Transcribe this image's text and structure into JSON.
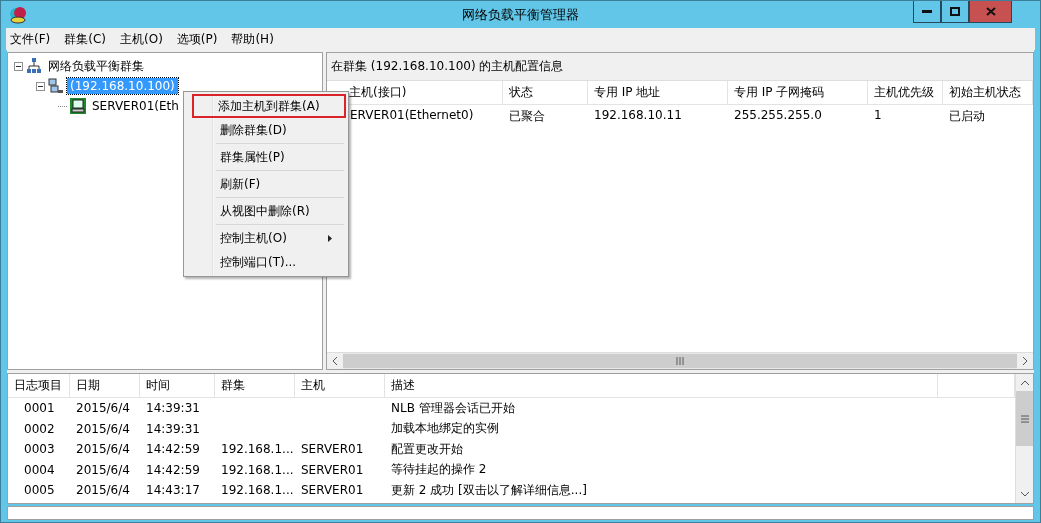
{
  "window": {
    "title": "网络负载平衡管理器"
  },
  "menu_bar": [
    "文件(F)",
    "群集(C)",
    "主机(O)",
    "选项(P)",
    "帮助(H)"
  ],
  "tree": {
    "label": "网络负载平衡群集",
    "selected": false,
    "expanded": true,
    "children": [
      {
        "label": "(192.168.10.100)",
        "selected": true,
        "expanded": true,
        "children": [
          {
            "label": "SERVER01(Eth",
            "selected": false
          }
        ]
      }
    ]
  },
  "details": {
    "caption": "在群集 (192.168.10.100) 的主机配置信息",
    "columns": [
      "主机(接口)",
      "状态",
      "专用 IP 地址",
      "专用 IP 子网掩码",
      "主机优先级",
      "初始主机状态"
    ],
    "rows": [
      [
        "ERVER01(Ethernet0)",
        "已聚合",
        "192.168.10.11",
        "255.255.255.0",
        "1",
        "已启动"
      ]
    ]
  },
  "context_menu": [
    {
      "label": "添加主机到群集(A)",
      "highlighted": true,
      "separator_after": false,
      "submenu": false
    },
    {
      "label": "删除群集(D)",
      "highlighted": false,
      "separator_after": true,
      "submenu": false
    },
    {
      "label": "群集属性(P)",
      "highlighted": false,
      "separator_after": true,
      "submenu": false
    },
    {
      "label": "刷新(F)",
      "highlighted": false,
      "separator_after": true,
      "submenu": false
    },
    {
      "label": "从视图中删除(R)",
      "highlighted": false,
      "separator_after": true,
      "submenu": false
    },
    {
      "label": "控制主机(O)",
      "highlighted": false,
      "separator_after": false,
      "submenu": true
    },
    {
      "label": "控制端口(T)...",
      "highlighted": false,
      "separator_after": false,
      "submenu": false
    }
  ],
  "log": {
    "columns": [
      "日志项目",
      "日期",
      "时间",
      "群集",
      "主机",
      "描述"
    ],
    "rows": [
      [
        "0001",
        "2015/6/4",
        "14:39:31",
        "",
        "",
        "NLB 管理器会话已开始"
      ],
      [
        "0002",
        "2015/6/4",
        "14:39:31",
        "",
        "",
        "加载本地绑定的实例"
      ],
      [
        "0003",
        "2015/6/4",
        "14:42:59",
        "192.168.1...",
        "SERVER01",
        "配置更改开始"
      ],
      [
        "0004",
        "2015/6/4",
        "14:42:59",
        "192.168.1...",
        "SERVER01",
        "等待挂起的操作 2"
      ],
      [
        "0005",
        "2015/6/4",
        "14:43:17",
        "192.168.1...",
        "SERVER01",
        "更新 2 成功 [双击以了解详细信息...]"
      ]
    ]
  }
}
